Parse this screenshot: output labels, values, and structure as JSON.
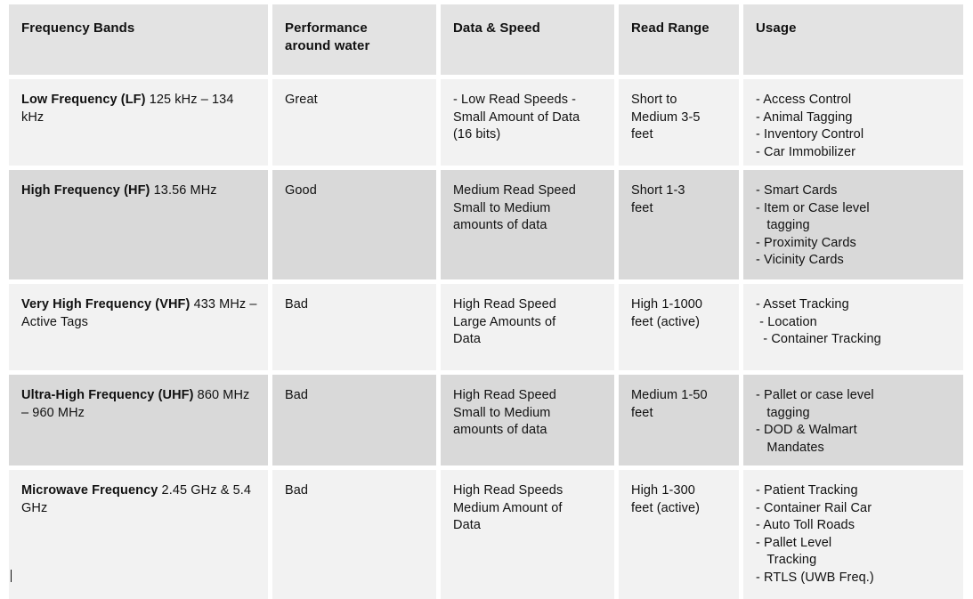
{
  "table": {
    "headers": [
      "Frequency Bands",
      "Performance\naround water",
      "Data & Speed",
      "Read Range",
      "Usage"
    ],
    "rows": [
      {
        "band_bold": "Low Frequency (LF)",
        "band_rest": " 125 kHz – 134 kHz",
        "performance": "Great",
        "data_speed": "- Low Read Speeds -\nSmall Amount of Data\n(16 bits)",
        "read_range": "Short to\nMedium 3-5\nfeet",
        "usage": [
          "- Access Control",
          "- Animal Tagging",
          "- Inventory Control",
          "- Car Immobilizer"
        ]
      },
      {
        "band_bold": "High Frequency (HF)",
        "band_rest": " 13.56 MHz",
        "performance": "Good",
        "data_speed": "Medium Read Speed\nSmall to Medium\namounts of data",
        "read_range": "Short 1-3\nfeet",
        "usage": [
          "- Smart Cards",
          "- Item or Case level\n   tagging",
          "- Proximity Cards",
          "- Vicinity Cards"
        ]
      },
      {
        "band_bold": "Very High Frequency (VHF)",
        "band_rest": " 433 MHz – Active Tags",
        "performance": "Bad",
        "data_speed": "High Read Speed\nLarge Amounts of\nData",
        "read_range": "High 1-1000\nfeet (active)",
        "usage": [
          "- Asset Tracking",
          " - Location",
          "  - Container Tracking"
        ]
      },
      {
        "band_bold": "Ultra-High Frequency (UHF)",
        "band_rest": " 860 MHz – 960 MHz",
        "performance": "Bad",
        "data_speed": "High Read Speed\nSmall to Medium\namounts of data",
        "read_range": "Medium 1-50\nfeet",
        "usage": [
          "- Pallet or case level\n   tagging",
          "- DOD & Walmart\n   Mandates"
        ]
      },
      {
        "band_bold": "Microwave Frequency",
        "band_rest": " 2.45 GHz & 5.4 GHz",
        "performance": "Bad",
        "data_speed": "High Read Speeds\nMedium Amount of\nData",
        "read_range": "High 1-300\nfeet (active)",
        "usage": [
          "- Patient Tracking",
          "- Container Rail Car",
          "- Auto Toll Roads",
          "- Pallet Level\n   Tracking",
          "- RTLS (UWB Freq.)"
        ]
      }
    ]
  },
  "colors": {
    "header_bg": "#e3e3e3",
    "row_light_bg": "#f2f2f2",
    "row_dark_bg": "#d9d9d9",
    "text": "#111111",
    "page_bg": "#ffffff"
  }
}
